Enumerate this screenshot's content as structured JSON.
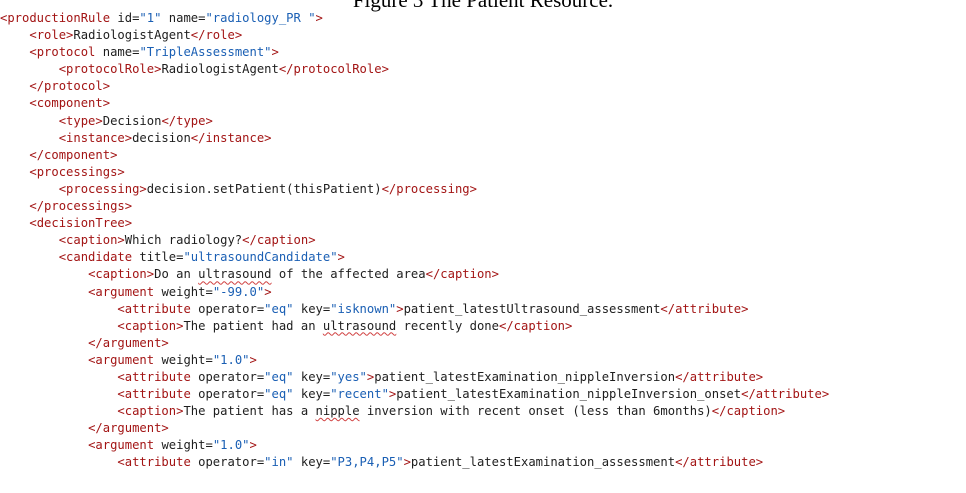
{
  "figure_caption": "Figure 3 The Patient Resource.",
  "colors": {
    "tag": "#a31515",
    "attribute_name": "#1e1e1e",
    "attribute_value": "#1a5fb4",
    "text": "#1e1e1e",
    "spell_underline": "#d04040"
  },
  "code_lines": [
    {
      "indent": 0,
      "tokens": [
        {
          "t": "tag",
          "v": "<productionRule"
        },
        {
          "t": "attr",
          "v": " id="
        },
        {
          "t": "str",
          "v": "\"1\""
        },
        {
          "t": "attr",
          "v": " name="
        },
        {
          "t": "str",
          "v": "\"radiology_PR \""
        },
        {
          "t": "tag",
          "v": ">"
        }
      ]
    },
    {
      "indent": 1,
      "tokens": [
        {
          "t": "tag",
          "v": "<role>"
        },
        {
          "t": "txt",
          "v": "RadiologistAgent"
        },
        {
          "t": "tag",
          "v": "</role>"
        }
      ]
    },
    {
      "indent": 1,
      "tokens": [
        {
          "t": "tag",
          "v": "<protocol"
        },
        {
          "t": "attr",
          "v": " name="
        },
        {
          "t": "str",
          "v": "\"TripleAssessment\""
        },
        {
          "t": "tag",
          "v": ">"
        }
      ]
    },
    {
      "indent": 2,
      "tokens": [
        {
          "t": "tag",
          "v": "<protocolRole>"
        },
        {
          "t": "txt",
          "v": "RadiologistAgent"
        },
        {
          "t": "tag",
          "v": "</protocolRole>"
        }
      ]
    },
    {
      "indent": 1,
      "tokens": [
        {
          "t": "tag",
          "v": "</protocol>"
        }
      ]
    },
    {
      "indent": 1,
      "tokens": [
        {
          "t": "tag",
          "v": "<component>"
        }
      ]
    },
    {
      "indent": 2,
      "tokens": [
        {
          "t": "tag",
          "v": "<type>"
        },
        {
          "t": "txt",
          "v": "Decision"
        },
        {
          "t": "tag",
          "v": "</type>"
        }
      ]
    },
    {
      "indent": 2,
      "tokens": [
        {
          "t": "tag",
          "v": "<instance>"
        },
        {
          "t": "txt",
          "v": "decision"
        },
        {
          "t": "tag",
          "v": "</instance>"
        }
      ]
    },
    {
      "indent": 1,
      "tokens": [
        {
          "t": "tag",
          "v": "</component>"
        }
      ]
    },
    {
      "indent": 1,
      "tokens": [
        {
          "t": "tag",
          "v": "<processings>"
        }
      ]
    },
    {
      "indent": 2,
      "tokens": [
        {
          "t": "tag",
          "v": "<processing>"
        },
        {
          "t": "txt",
          "v": "decision.setPatient(thisPatient)"
        },
        {
          "t": "tag",
          "v": "</processing>"
        }
      ]
    },
    {
      "indent": 1,
      "tokens": [
        {
          "t": "tag",
          "v": "</processings>"
        }
      ]
    },
    {
      "indent": 1,
      "tokens": [
        {
          "t": "tag",
          "v": "<decisionTree>"
        }
      ]
    },
    {
      "indent": 2,
      "tokens": [
        {
          "t": "tag",
          "v": "<caption>"
        },
        {
          "t": "txt",
          "v": "Which radiology?"
        },
        {
          "t": "tag",
          "v": "</caption>"
        }
      ]
    },
    {
      "indent": 2,
      "tokens": [
        {
          "t": "tag",
          "v": "<candidate"
        },
        {
          "t": "attr",
          "v": " title="
        },
        {
          "t": "str",
          "v": "\"ultrasoundCandidate\""
        },
        {
          "t": "tag",
          "v": ">"
        }
      ]
    },
    {
      "indent": 3,
      "tokens": [
        {
          "t": "tag",
          "v": "<caption>"
        },
        {
          "t": "txt",
          "v": "Do an "
        },
        {
          "t": "squiggle",
          "v": "ultrasound"
        },
        {
          "t": "txt",
          "v": " of the affected area"
        },
        {
          "t": "tag",
          "v": "</caption>"
        }
      ]
    },
    {
      "indent": 3,
      "tokens": [
        {
          "t": "tag",
          "v": "<argument"
        },
        {
          "t": "attr",
          "v": " weight="
        },
        {
          "t": "str",
          "v": "\"-99.0\""
        },
        {
          "t": "tag",
          "v": ">"
        }
      ]
    },
    {
      "indent": 4,
      "tokens": [
        {
          "t": "tag",
          "v": "<attribute"
        },
        {
          "t": "attr",
          "v": " operator="
        },
        {
          "t": "str",
          "v": "\"eq\""
        },
        {
          "t": "attr",
          "v": " key="
        },
        {
          "t": "str",
          "v": "\"isknown\""
        },
        {
          "t": "tag",
          "v": ">"
        },
        {
          "t": "txt",
          "v": "patient_latestUltrasound_assessment"
        },
        {
          "t": "tag",
          "v": "</attribute>"
        }
      ]
    },
    {
      "indent": 4,
      "tokens": [
        {
          "t": "tag",
          "v": "<caption>"
        },
        {
          "t": "txt",
          "v": "The patient had an "
        },
        {
          "t": "squiggle",
          "v": "ultrasound"
        },
        {
          "t": "txt",
          "v": " recently done"
        },
        {
          "t": "tag",
          "v": "</caption>"
        }
      ]
    },
    {
      "indent": 3,
      "tokens": [
        {
          "t": "tag",
          "v": "</argument>"
        }
      ]
    },
    {
      "indent": 3,
      "tokens": [
        {
          "t": "tag",
          "v": "<argument"
        },
        {
          "t": "attr",
          "v": " weight="
        },
        {
          "t": "str",
          "v": "\"1.0\""
        },
        {
          "t": "tag",
          "v": ">"
        }
      ]
    },
    {
      "indent": 4,
      "tokens": [
        {
          "t": "tag",
          "v": "<attribute"
        },
        {
          "t": "attr",
          "v": " operator="
        },
        {
          "t": "str",
          "v": "\"eq\""
        },
        {
          "t": "attr",
          "v": " key="
        },
        {
          "t": "str",
          "v": "\"yes\""
        },
        {
          "t": "tag",
          "v": ">"
        },
        {
          "t": "txt",
          "v": "patient_latestExamination_nippleInversion"
        },
        {
          "t": "tag",
          "v": "</attribute>"
        }
      ]
    },
    {
      "indent": 4,
      "tokens": [
        {
          "t": "tag",
          "v": "<attribute"
        },
        {
          "t": "attr",
          "v": " operator="
        },
        {
          "t": "str",
          "v": "\"eq\""
        },
        {
          "t": "attr",
          "v": " key="
        },
        {
          "t": "str",
          "v": "\"recent\""
        },
        {
          "t": "tag",
          "v": ">"
        },
        {
          "t": "txt",
          "v": "patient_latestExamination_nippleInversion_onset"
        },
        {
          "t": "tag",
          "v": "</attribute>"
        }
      ]
    },
    {
      "indent": 4,
      "tokens": [
        {
          "t": "tag",
          "v": "<caption>"
        },
        {
          "t": "txt",
          "v": "The patient has a "
        },
        {
          "t": "squiggle",
          "v": "nipple"
        },
        {
          "t": "txt",
          "v": " inversion with recent onset (less than 6months)"
        },
        {
          "t": "tag",
          "v": "</caption>"
        }
      ]
    },
    {
      "indent": 3,
      "tokens": [
        {
          "t": "tag",
          "v": "</argument>"
        }
      ]
    },
    {
      "indent": 3,
      "tokens": [
        {
          "t": "tag",
          "v": "<argument"
        },
        {
          "t": "attr",
          "v": " weight="
        },
        {
          "t": "str",
          "v": "\"1.0\""
        },
        {
          "t": "tag",
          "v": ">"
        }
      ]
    },
    {
      "indent": 4,
      "tokens": [
        {
          "t": "tag",
          "v": "<attribute"
        },
        {
          "t": "attr",
          "v": " operator="
        },
        {
          "t": "str",
          "v": "\"in\""
        },
        {
          "t": "attr",
          "v": " key="
        },
        {
          "t": "str",
          "v": "\"P3,P4,P5\""
        },
        {
          "t": "tag",
          "v": ">"
        },
        {
          "t": "txt",
          "v": "patient_latestExamination_assessment"
        },
        {
          "t": "tag",
          "v": "</attribute>"
        }
      ]
    }
  ]
}
